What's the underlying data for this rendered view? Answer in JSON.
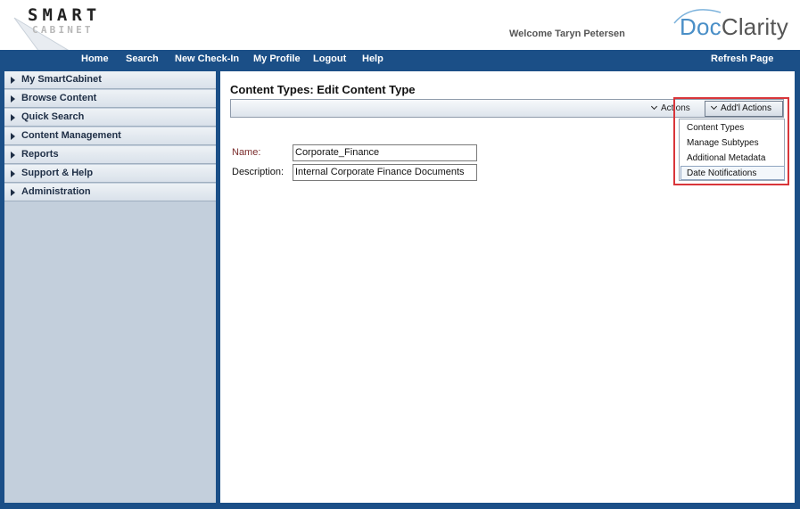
{
  "header": {
    "logo_primary": "SMART",
    "logo_secondary": "CABINET",
    "welcome_text": "Welcome Taryn Petersen",
    "brand_doc": "Doc",
    "brand_clarity": "Clarity"
  },
  "navbar": {
    "items": [
      "Home",
      "Search",
      "New Check-In",
      "My Profile",
      "Logout",
      "Help"
    ],
    "refresh_label": "Refresh Page"
  },
  "sidebar": {
    "items": [
      "My SmartCabinet",
      "Browse Content",
      "Quick Search",
      "Content Management",
      "Reports",
      "Support & Help",
      "Administration"
    ]
  },
  "main": {
    "page_title": "Content Types: Edit Content Type",
    "actions_label": "Actions",
    "addl_actions_label": "Add'l Actions",
    "addl_menu": [
      "Content Types",
      "Manage Subtypes",
      "Additional Metadata",
      "Date Notifications"
    ],
    "name_label": "Name:",
    "name_value": "Corporate_Finance",
    "description_label": "Description:",
    "description_value": "Internal Corporate Finance Documents"
  },
  "colors": {
    "frame_blue": "#1b4f87",
    "sidebar_bg": "#c3cfdc",
    "name_label_color": "#7a2b2b",
    "highlight_red": "#d9353a",
    "brand_blue": "#4a8fc7"
  }
}
